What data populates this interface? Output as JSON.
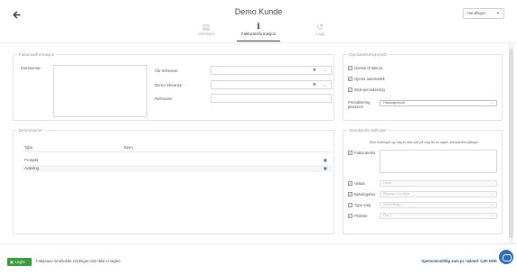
{
  "header": {
    "back_icon": "arrow-left-icon",
    "title": "Demo Kunde",
    "actions_label": "Handlinger"
  },
  "tabs": [
    {
      "label": "Varelinjer",
      "icon": "cart-icon"
    },
    {
      "label": "Fakturainformasjon",
      "icon": "info-icon"
    },
    {
      "label": "Logg",
      "icon": "history-icon"
    }
  ],
  "invoice_info": {
    "legend": "Fakturainformasjon",
    "comment_label": "Kommentar:",
    "our_reference_label": "Vår referanse:",
    "your_reference_label": "Deres referanse:",
    "reference_label": "Referanse:"
  },
  "dimensions": {
    "legend": "Dimensjoner",
    "col_type": "Type",
    "col_name": "Navn",
    "rows": [
      {
        "type": "Prosjekt",
        "name": ""
      },
      {
        "type": "Avdeling",
        "name": ""
      }
    ]
  },
  "sending": {
    "legend": "Gjentakelsesoppsett",
    "direct_invoice": "Direkte til faktura",
    "send_auto": "Gjenta automatisk",
    "use_period": "Bruk periodisering",
    "period_label": "Periodisering plasserer",
    "period_value": "Fakturaperiode"
  },
  "defaults": {
    "legend": "Standardinnstillinger",
    "hint": "Dine endringer og valg er ikke satt på valg før du lagrer standardinnstillinger",
    "invoice_text_label": "Fakturatekst",
    "currency_label": "Valuta",
    "currency_value": "Lokal",
    "payment_terms_label": "Betalingsbet.",
    "payment_terms_value": "Standard 14 dager",
    "sale_type_label": "Type salg",
    "sale_type_value": "Innlandsalg",
    "price_list_label": "Prisliste",
    "price_list_value": "Pris 1"
  },
  "footer": {
    "save_label": "Lagre",
    "save_hint": "Fakturaen inneholder endringer som ikke er lagret.",
    "average_text": "Gjennomsnittlig sum pr. måned: 0,00 NOK"
  },
  "colors": {
    "accent": "#2b6cb0",
    "save": "#3b9a3f"
  }
}
